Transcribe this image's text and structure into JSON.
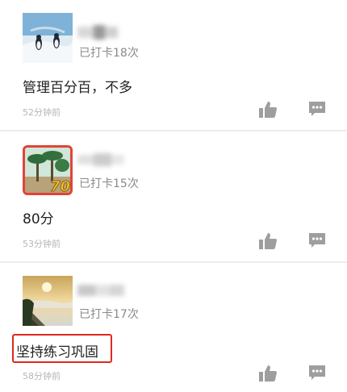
{
  "posts": [
    {
      "checkin_label": "已打卡18次",
      "content": "管理百分百，不多",
      "time": "52分钟前"
    },
    {
      "checkin_label": "已打卡15次",
      "content": "80分",
      "time": "53分钟前",
      "avatar_badge": "70"
    },
    {
      "checkin_label": "已打卡17次",
      "content": "坚持练习巩固",
      "time": "58分钟前"
    }
  ],
  "colors": {
    "highlight": "#e0281e",
    "icon": "#9e9e9e",
    "secondary_text": "#8a8a8a",
    "time_text": "#b5b5b5"
  },
  "icons": {
    "like": "thumbs-up-icon",
    "comment": "comment-icon"
  }
}
